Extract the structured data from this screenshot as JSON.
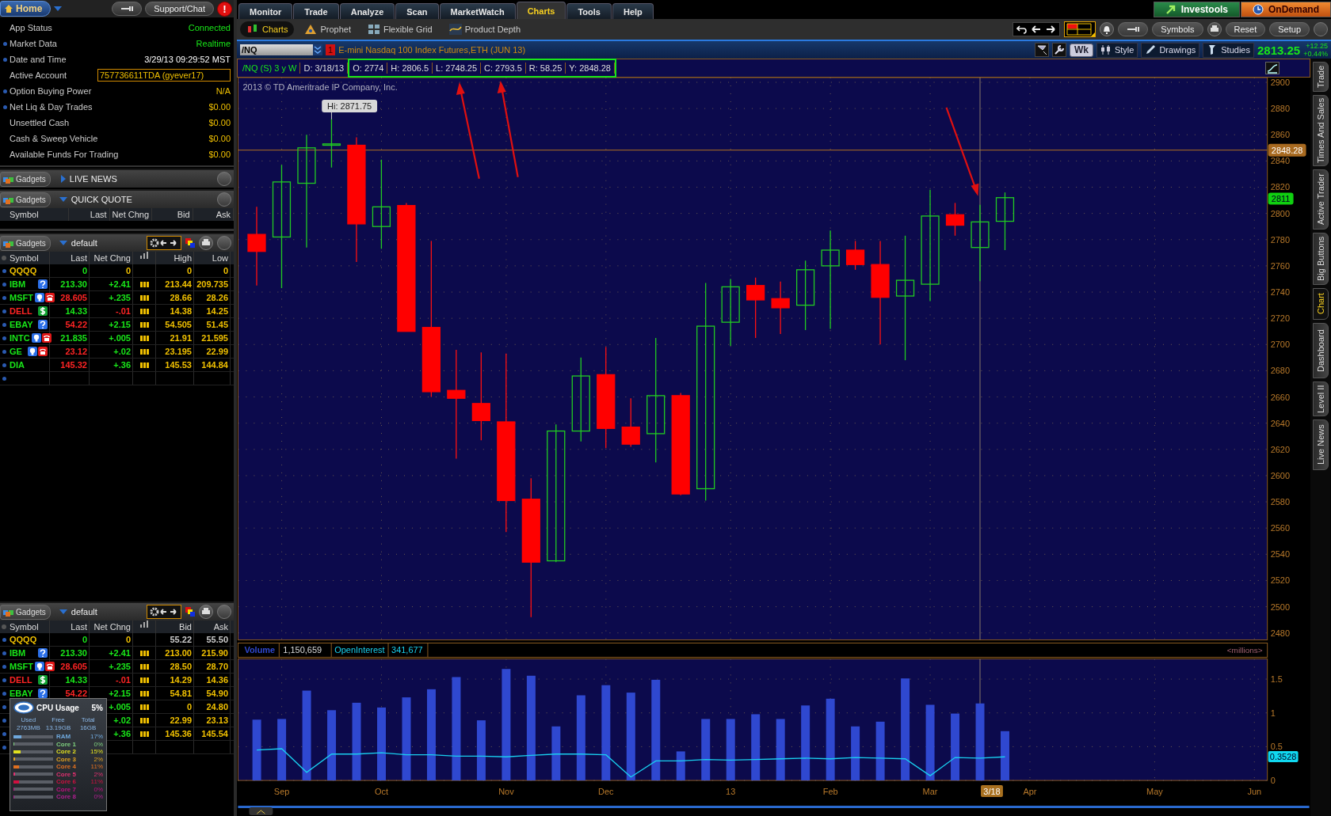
{
  "left_panel": {
    "home_button": "Home",
    "support_button": "Support/Chat",
    "alert_badge": "!",
    "account_info": [
      {
        "label": "App Status",
        "value": "Connected",
        "kind": "status",
        "dot": false
      },
      {
        "label": "Market Data",
        "value": "Realtime",
        "kind": "status",
        "dot": true
      },
      {
        "label": "Date and Time",
        "value": "3/29/13 09:29:52 MST",
        "kind": "plain",
        "dot": true
      },
      {
        "label": "Active Account",
        "value": "757736611TDA (gyever17)",
        "kind": "field",
        "dot": false
      },
      {
        "label": "Option Buying Power",
        "value": "N/A",
        "kind": "amount",
        "dot": true
      },
      {
        "label": "Net Liq & Day Trades",
        "value": "$0.00",
        "kind": "amount",
        "dot": true
      },
      {
        "label": "Unsettled Cash",
        "value": "$0.00",
        "kind": "amount",
        "dot": false
      },
      {
        "label": "Cash & Sweep Vehicle",
        "value": "$0.00",
        "kind": "amount",
        "dot": false
      },
      {
        "label": "Available Funds For Trading",
        "value": "$0.00",
        "kind": "amount",
        "dot": false
      }
    ],
    "live_news": {
      "gadgets": "Gadgets",
      "title": "LIVE NEWS",
      "expanded": false
    },
    "quick_quote": {
      "gadgets": "Gadgets",
      "title": "QUICK QUOTE",
      "expanded": true,
      "columns": [
        "Symbol",
        "Last",
        "Net Chng",
        "Bid",
        "Ask"
      ]
    },
    "watchlists": [
      {
        "gadgets": "Gadgets",
        "title": "default",
        "columns": [
          "Symbol",
          "Last",
          "Net Chng",
          "High",
          "Low"
        ],
        "rows": [
          {
            "symbol": {
              "text": "QQQQ",
              "color": "#f0c000"
            },
            "icons": [],
            "last": {
              "text": "0",
              "color": "#19e619"
            },
            "change": {
              "text": "0",
              "color": "#f0c000"
            },
            "chart_icon": false,
            "values": [
              "0",
              "0"
            ],
            "values_live": true
          },
          {
            "symbol": {
              "text": "IBM",
              "color": "#19e619"
            },
            "icons": [
              {
                "kind": "help"
              }
            ],
            "last": {
              "text": "213.30",
              "color": "#19e619"
            },
            "change": {
              "text": "+2.41",
              "color": "#19e619"
            },
            "chart_icon": true,
            "values": [
              "213.44",
              "209.735"
            ],
            "values_live": true
          },
          {
            "symbol": {
              "text": "MSFT",
              "color": "#19e619"
            },
            "icons": [
              {
                "kind": "bulb"
              },
              {
                "kind": "phone"
              }
            ],
            "last": {
              "text": "28.605",
              "color": "#ff2424"
            },
            "change": {
              "text": "+.235",
              "color": "#19e619"
            },
            "chart_icon": true,
            "values": [
              "28.66",
              "28.26"
            ],
            "values_live": true
          },
          {
            "symbol": {
              "text": "DELL",
              "color": "#ff2424"
            },
            "icons": [
              {
                "kind": "dollar"
              }
            ],
            "last": {
              "text": "14.33",
              "color": "#19e619"
            },
            "change": {
              "text": "-.01",
              "color": "#ff2424"
            },
            "chart_icon": true,
            "values": [
              "14.38",
              "14.25"
            ],
            "values_live": true
          },
          {
            "symbol": {
              "text": "EBAY",
              "color": "#19e619"
            },
            "icons": [
              {
                "kind": "help"
              }
            ],
            "last": {
              "text": "54.22",
              "color": "#ff2424"
            },
            "change": {
              "text": "+2.15",
              "color": "#19e619"
            },
            "chart_icon": true,
            "values": [
              "54.505",
              "51.45"
            ],
            "values_live": true
          },
          {
            "symbol": {
              "text": "INTC",
              "color": "#19e619"
            },
            "icons": [
              {
                "kind": "bulb"
              },
              {
                "kind": "phone"
              }
            ],
            "last": {
              "text": "21.835",
              "color": "#19e619"
            },
            "change": {
              "text": "+.005",
              "color": "#19e619"
            },
            "chart_icon": true,
            "values": [
              "21.91",
              "21.595"
            ],
            "values_live": true
          },
          {
            "symbol": {
              "text": "GE",
              "color": "#19e619"
            },
            "icons": [
              {
                "kind": "bulb"
              },
              {
                "kind": "phone"
              }
            ],
            "last": {
              "text": "23.12",
              "color": "#ff2424"
            },
            "change": {
              "text": "+.02",
              "color": "#19e619"
            },
            "chart_icon": true,
            "values": [
              "23.195",
              "22.99"
            ],
            "values_live": true
          },
          {
            "symbol": {
              "text": "DIA",
              "color": "#19e619"
            },
            "icons": [],
            "last": {
              "text": "145.32",
              "color": "#ff2424"
            },
            "change": {
              "text": "+.36",
              "color": "#19e619"
            },
            "chart_icon": true,
            "values": [
              "145.53",
              "144.84"
            ],
            "values_live": true
          }
        ]
      },
      {
        "gadgets": "Gadgets",
        "title": "default",
        "columns": [
          "Symbol",
          "Last",
          "Net Chng",
          "Bid",
          "Ask"
        ],
        "rows": [
          {
            "symbol": {
              "text": "QQQQ",
              "color": "#f0c000"
            },
            "icons": [],
            "last": {
              "text": "0",
              "color": "#19e619"
            },
            "change": {
              "text": "0",
              "color": "#f0c000"
            },
            "chart_icon": false,
            "values": [
              "55.22",
              "55.50"
            ],
            "values_live": false
          },
          {
            "symbol": {
              "text": "IBM",
              "color": "#19e619"
            },
            "icons": [
              {
                "kind": "help"
              }
            ],
            "last": {
              "text": "213.30",
              "color": "#19e619"
            },
            "change": {
              "text": "+2.41",
              "color": "#19e619"
            },
            "chart_icon": true,
            "values": [
              "213.00",
              "215.90"
            ],
            "values_live": true
          },
          {
            "symbol": {
              "text": "MSFT",
              "color": "#19e619"
            },
            "icons": [
              {
                "kind": "bulb"
              },
              {
                "kind": "phone"
              }
            ],
            "last": {
              "text": "28.605",
              "color": "#ff2424"
            },
            "change": {
              "text": "+.235",
              "color": "#19e619"
            },
            "chart_icon": true,
            "values": [
              "28.50",
              "28.70"
            ],
            "values_live": true
          },
          {
            "symbol": {
              "text": "DELL",
              "color": "#ff2424"
            },
            "icons": [
              {
                "kind": "dollar"
              }
            ],
            "last": {
              "text": "14.33",
              "color": "#19e619"
            },
            "change": {
              "text": "-.01",
              "color": "#ff2424"
            },
            "chart_icon": true,
            "values": [
              "14.29",
              "14.36"
            ],
            "values_live": true
          },
          {
            "symbol": {
              "text": "EBAY",
              "color": "#19e619"
            },
            "icons": [
              {
                "kind": "help"
              }
            ],
            "last": {
              "text": "54.22",
              "color": "#ff2424"
            },
            "change": {
              "text": "+2.15",
              "color": "#19e619"
            },
            "chart_icon": true,
            "values": [
              "54.81",
              "54.90"
            ],
            "values_live": true
          },
          {
            "icons": [],
            "change": {
              "text": "+.005",
              "color": "#19e619"
            },
            "chart_icon": true,
            "values": [
              "0",
              "24.80"
            ],
            "values_live": true
          },
          {
            "icons": [],
            "change": {
              "text": "+.02",
              "color": "#19e619"
            },
            "chart_icon": true,
            "values": [
              "22.99",
              "23.13"
            ],
            "values_live": true
          },
          {
            "icons": [],
            "change": {
              "text": "+.36",
              "color": "#19e619"
            },
            "chart_icon": true,
            "values": [
              "145.36",
              "145.54"
            ],
            "values_live": true
          }
        ]
      }
    ],
    "cpu_widget": {
      "title": "CPU Usage",
      "total": "5%",
      "columns": [
        "Used",
        "Free",
        "Total"
      ],
      "values": [
        "2763MB",
        "13.19GB",
        "16GB"
      ],
      "rows": [
        {
          "label": "RAM",
          "percent": "17%",
          "level": 0.17,
          "color": "#6fa8dc"
        },
        {
          "label": "Core 1",
          "percent": "0%",
          "level": 0,
          "color": "#7fd07f"
        },
        {
          "label": "Core 2",
          "percent": "15%",
          "level": 0.15,
          "color": "#e0e020"
        },
        {
          "label": "Core 3",
          "percent": "2%",
          "level": 0.02,
          "color": "#e0a020"
        },
        {
          "label": "Core 4",
          "percent": "11%",
          "level": 0.11,
          "color": "#e07020"
        },
        {
          "label": "Core 5",
          "percent": "2%",
          "level": 0.02,
          "color": "#e03070"
        },
        {
          "label": "Core 6",
          "percent": "11%",
          "level": 0.11,
          "color": "#d01040"
        },
        {
          "label": "Core 7",
          "percent": "0%",
          "level": 0,
          "color": "#c01080"
        },
        {
          "label": "Core 8",
          "percent": "0%",
          "level": 0,
          "color": "#b02090"
        }
      ]
    }
  },
  "main_tabs": [
    {
      "label": "Monitor",
      "selected": false
    },
    {
      "label": "Trade",
      "selected": false
    },
    {
      "label": "Analyze",
      "selected": false
    },
    {
      "label": "Scan",
      "selected": false
    },
    {
      "label": "MarketWatch",
      "selected": false
    },
    {
      "label": "Charts",
      "selected": true
    },
    {
      "label": "Tools",
      "selected": false
    },
    {
      "label": "Help",
      "selected": false
    }
  ],
  "top_buttons": [
    {
      "label": "Investools",
      "kind": "investools"
    },
    {
      "label": "OnDemand",
      "kind": "ondemand"
    }
  ],
  "sub_tabs": [
    {
      "label": "Charts",
      "selected": true
    },
    {
      "label": "Prophet",
      "selected": false
    },
    {
      "label": "Flexible Grid",
      "selected": false
    },
    {
      "label": "Product Depth",
      "selected": false
    }
  ],
  "toolbar_buttons": {
    "symbols": "Symbols",
    "reset": "Reset",
    "setup": "Setup"
  },
  "chart": {
    "symbol": "/NQ",
    "badge": "1",
    "title": "E-mini Nasdaq 100 Index Futures,ETH (JUN 13)",
    "period": "Wk",
    "tools": [
      "Style",
      "Drawings",
      "Studies"
    ],
    "last_price": "2813.25",
    "change": "+12.25",
    "change_pct": "+0.44%",
    "info_lead": [
      "/NQ (S) 3 y W",
      "D: 3/18/13"
    ],
    "info_values": [
      "O: 2774",
      "H: 2806.5",
      "L: 2748.25",
      "C: 2793.5",
      "R: 58.25",
      "Y: 2848.28"
    ],
    "copyright": "2013 © TD Ameritrade IP Company, Inc.",
    "high_callout": "Hi: 2871.75",
    "price_axis": [
      "2900",
      "2880",
      "2860",
      "2840",
      "2820",
      "2800",
      "2780",
      "2760",
      "2740",
      "2720",
      "2700",
      "2680",
      "2660",
      "2640",
      "2620",
      "2600",
      "2580",
      "2560",
      "2540",
      "2520",
      "2500",
      "2480"
    ],
    "crosshair_price": "2848.28",
    "last_marker": "2811",
    "volume_panel": {
      "readings": [
        "1,150,659",
        "341,677"
      ],
      "units": "<millions>",
      "oi_marker": "0.3528",
      "date_marker": "3/18",
      "chart_data": {
        "type": "bar",
        "grid": true,
        "ylim": [
          0,
          1.8
        ],
        "categories": [
          null,
          "Sep",
          null,
          null,
          null,
          "Oct",
          null,
          null,
          null,
          null,
          "Nov",
          null,
          null,
          null,
          "Dec",
          null,
          null,
          null,
          null,
          "13",
          null,
          null,
          null,
          "Feb",
          null,
          null,
          null,
          "Mar",
          null,
          null,
          null,
          "Apr",
          null,
          null,
          null,
          null,
          "May",
          null,
          null,
          null,
          "Jun"
        ],
        "yticks": [
          0,
          0.5,
          1,
          1.5
        ],
        "series": [
          {
            "name": "Volume",
            "color": "#2f48d0",
            "values": [
              0.9,
              0.91,
              1.33,
              1.04,
              1.15,
              1.08,
              1.23,
              1.35,
              1.53,
              0.89,
              1.65,
              1.55,
              0.8,
              1.26,
              1.41,
              1.3,
              1.49,
              0.43,
              0.91,
              0.91,
              0.98,
              0.91,
              1.11,
              1.21,
              0.8,
              0.87,
              1.51,
              1.12,
              0.99,
              1.14,
              0.73,
              null,
              null,
              null,
              null,
              null,
              null,
              null,
              null,
              null,
              null
            ]
          },
          {
            "name": "OpenInterest",
            "type": "line",
            "color": "#19d0f0",
            "values": [
              0.45,
              0.47,
              0.12,
              0.39,
              0.39,
              0.41,
              0.38,
              0.38,
              0.36,
              0.36,
              0.35,
              0.37,
              0.39,
              0.39,
              0.38,
              0.05,
              0.29,
              0.29,
              0.31,
              0.3,
              0.31,
              0.32,
              0.33,
              0.32,
              0.34,
              0.33,
              0.32,
              0.07,
              0.34,
              0.33,
              0.35,
              null,
              null,
              null,
              null,
              null,
              null,
              null,
              null,
              null,
              null
            ]
          }
        ]
      }
    }
  },
  "side_tabs": [
    {
      "label": "Trade",
      "selected": false
    },
    {
      "label": "Times And Sales",
      "selected": false
    },
    {
      "label": "Active Trader",
      "selected": false
    },
    {
      "label": "Big Buttons",
      "selected": false
    },
    {
      "label": "Chart",
      "selected": true
    },
    {
      "label": "Dashboard",
      "selected": false
    },
    {
      "label": "Level II",
      "selected": false
    },
    {
      "label": "Live News",
      "selected": false
    }
  ]
}
